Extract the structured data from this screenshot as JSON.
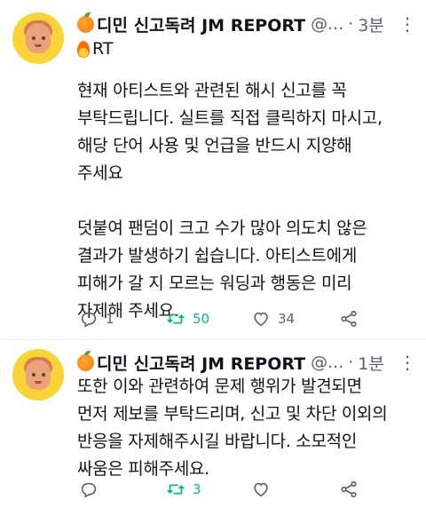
{
  "tweets": [
    {
      "display_name": "디민 신고독려 JM REPORT",
      "handle": "@...",
      "separator": "·",
      "time": "3분",
      "subline": "RT",
      "body": "현재 아티스트와 관련된 해시 신고를 꼭\n부탁드립니다. 실트를 직접 클릭하지 마시고,\n해당 단어 사용 및 언급을 반드시 지양해\n주세요\n\n덧붙여 팬덤이 크고 수가 많아 의도치 않은\n결과가 발생하기 쉽습니다. 아티스트에게\n피해가 갈 지 모르는 워딩과 행동은 미리\n자제해 주세요.",
      "replies": "1",
      "retweets": "50",
      "likes": "34"
    },
    {
      "display_name": "디민 신고독려 JM REPORT",
      "handle": "@...",
      "separator": "·",
      "time": "1분",
      "body": "또한 이와 관련하여 문제 행위가 발견되면\n먼저 제보를 부탁드리며, 신고 및 차단 이외의\n반응을 자제해주시길 바랍니다. 소모적인\n싸움은 피해주세요.",
      "replies": "",
      "retweets": "3",
      "likes": ""
    }
  ],
  "icons": {
    "more": "more-icon",
    "reply": "reply-icon",
    "retweet": "retweet-icon",
    "like": "heart-icon",
    "share": "share-icon",
    "name_emoji": "orange-icon",
    "subline_emoji": "fire-icon"
  },
  "colors": {
    "text": "#0f1419",
    "secondary": "#536471",
    "retweet_active": "#00ba7c",
    "avatar_bg": "#f9d338"
  }
}
